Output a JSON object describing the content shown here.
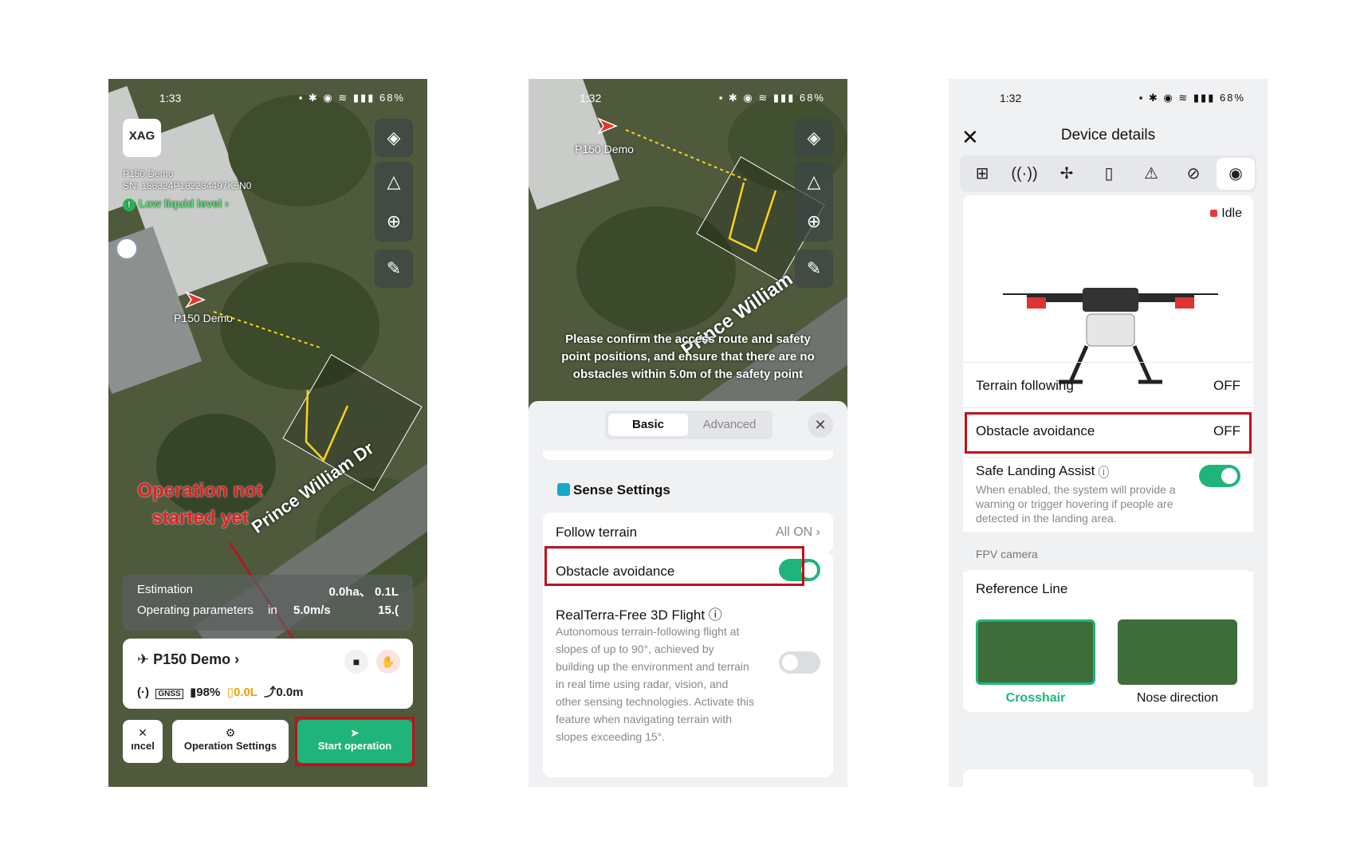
{
  "phone1": {
    "status": {
      "time": "1:33",
      "battery": "68%"
    },
    "logo": "XAG",
    "device_name": "P150 Demo",
    "serial": "SN: 186324P182234497K5N0",
    "alert": "Low liquid level",
    "map_drone_label": "P150 Demo",
    "street": "Prince William Dr",
    "annotation": [
      "Operation not",
      "started yet"
    ],
    "estimation": {
      "label": "Estimation",
      "value": "0.0ha、 0.1L"
    },
    "params": {
      "label": "Operating parameters",
      "v1": "in",
      "v2": "5.0m/s",
      "v3": "15.("
    },
    "card": {
      "name": "P150 Demo",
      "signal": "(·)",
      "gnss": "GNSS",
      "battery": "98%",
      "liquid": "0.0L",
      "height": "0.0m"
    },
    "buttons": {
      "cancel": "ıncel",
      "settings": "Operation Settings",
      "start": "Start operation"
    }
  },
  "phone2": {
    "status": {
      "time": "1:32",
      "battery": "68%"
    },
    "map_drone_label": "P150 Demo",
    "street": "Prince William",
    "banner": "Please confirm the access route and safety point positions, and ensure that there are no obstacles within 5.0m of the safety point",
    "tabs": {
      "basic": "Basic",
      "advanced": "Advanced"
    },
    "section": "Sense Settings",
    "follow_terrain": {
      "label": "Follow terrain",
      "value": "All ON"
    },
    "obstacle_avoidance": {
      "label": "Obstacle avoidance",
      "state": "on"
    },
    "realterra": {
      "label": "RealTerra-Free 3D Flight ⓘ",
      "desc": "Autonomous terrain-following flight at slopes of up to 90°, achieved by building up the environment and terrain in real time using radar, vision, and other sensing technologies. Activate this feature when navigating terrain with slopes exceeding 15°.",
      "state": "off"
    }
  },
  "phone3": {
    "status": {
      "time": "1:32",
      "battery": "68%"
    },
    "title": "Device details",
    "status_label": "Idle",
    "terrain": {
      "label": "Terrain following",
      "value": "OFF"
    },
    "obstacle": {
      "label": "Obstacle avoidance",
      "value": "OFF"
    },
    "safe_landing": {
      "label": "Safe Landing Assist",
      "info": "i",
      "desc": "When enabled, the system will provide a warning or trigger hovering if people are detected in the landing area.",
      "state": "on"
    },
    "fpv": "FPV camera",
    "reference": "Reference Line",
    "options": [
      "Crosshair",
      "Nose direction"
    ]
  },
  "colors": {
    "accent": "#1fb57a",
    "highlight": "#c0101c",
    "amber": "#f0a000"
  }
}
